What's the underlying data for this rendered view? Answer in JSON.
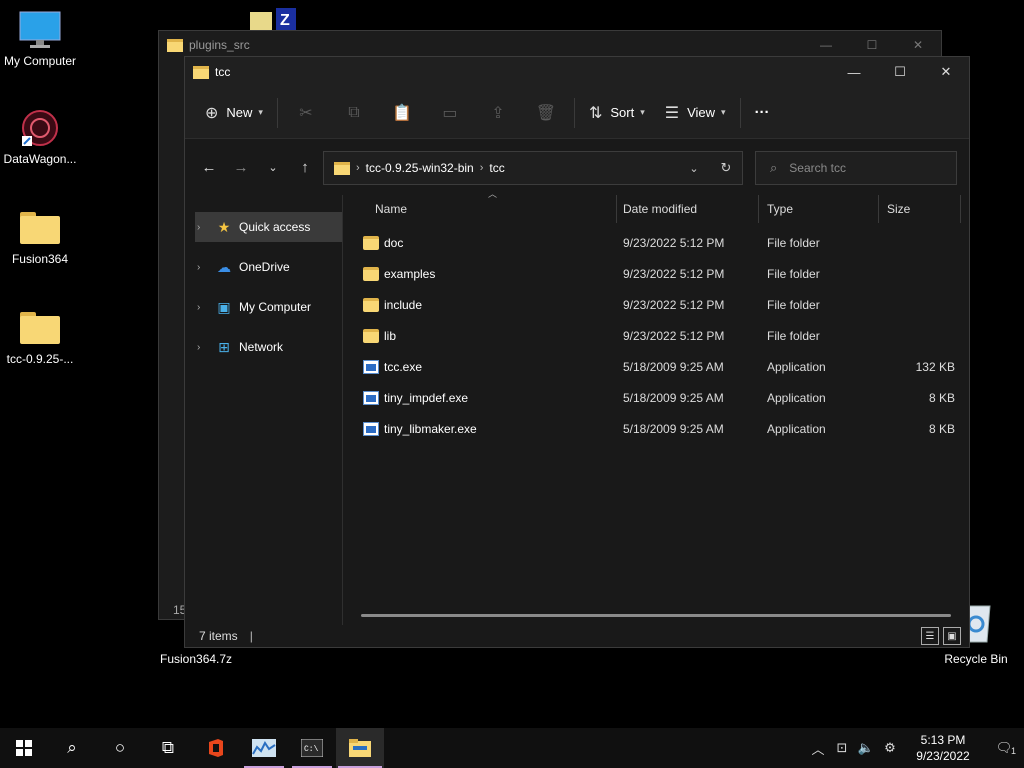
{
  "desktop": {
    "icons": [
      {
        "label": "My Computer"
      },
      {
        "label": "DataWagon..."
      },
      {
        "label": "Fusion364"
      },
      {
        "label": "tcc-0.9.25-..."
      }
    ],
    "zip_file_label": "Fusion364.7z",
    "recycle_bin_label": "Recycle Bin"
  },
  "back_window": {
    "title": "plugins_src",
    "status_fragment": "15"
  },
  "window": {
    "title": "tcc",
    "commandbar": {
      "new_label": "New",
      "sort_label": "Sort",
      "view_label": "View",
      "more_label": "···"
    },
    "address": {
      "segments": [
        "tcc-0.9.25-win32-bin",
        "tcc"
      ]
    },
    "search": {
      "placeholder": "Search tcc"
    },
    "sidebar": [
      {
        "label": "Quick access",
        "icon": "star-icon"
      },
      {
        "label": "OneDrive",
        "icon": "cloud-icon"
      },
      {
        "label": "My Computer",
        "icon": "computer-icon"
      },
      {
        "label": "Network",
        "icon": "network-icon"
      }
    ],
    "columns": {
      "name": "Name",
      "date": "Date modified",
      "type": "Type",
      "size": "Size"
    },
    "files": [
      {
        "name": "doc",
        "date": "9/23/2022 5:12 PM",
        "type": "File folder",
        "size": "",
        "kind": "folder"
      },
      {
        "name": "examples",
        "date": "9/23/2022 5:12 PM",
        "type": "File folder",
        "size": "",
        "kind": "folder"
      },
      {
        "name": "include",
        "date": "9/23/2022 5:12 PM",
        "type": "File folder",
        "size": "",
        "kind": "folder"
      },
      {
        "name": "lib",
        "date": "9/23/2022 5:12 PM",
        "type": "File folder",
        "size": "",
        "kind": "folder"
      },
      {
        "name": "tcc.exe",
        "date": "5/18/2009 9:25 AM",
        "type": "Application",
        "size": "132 KB",
        "kind": "exe"
      },
      {
        "name": "tiny_impdef.exe",
        "date": "5/18/2009 9:25 AM",
        "type": "Application",
        "size": "8 KB",
        "kind": "exe"
      },
      {
        "name": "tiny_libmaker.exe",
        "date": "5/18/2009 9:25 AM",
        "type": "Application",
        "size": "8 KB",
        "kind": "exe"
      }
    ],
    "status": "7 items"
  },
  "taskbar": {
    "clock_time": "5:13 PM",
    "clock_date": "9/23/2022",
    "notification_count": "1"
  }
}
